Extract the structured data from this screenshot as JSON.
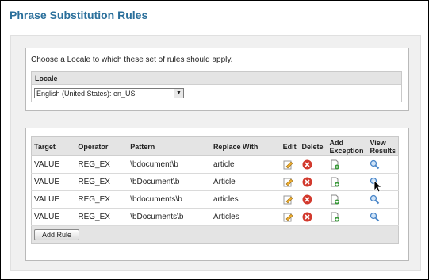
{
  "page": {
    "title": "Phrase Substitution Rules"
  },
  "locale_section": {
    "prompt": "Choose a Locale to which these set of rules should apply.",
    "header": "Locale",
    "selected_locale": "English (United States): en_US"
  },
  "rules": {
    "columns": {
      "target": "Target",
      "operator": "Operator",
      "pattern": "Pattern",
      "replace_with": "Replace With",
      "edit": "Edit",
      "delete": "Delete",
      "add_exception": "Add Exception",
      "view_results": "View Results"
    },
    "rows": [
      {
        "target": "VALUE",
        "operator": "REG_EX",
        "pattern": "\\bdocument\\b",
        "replace_with": "article"
      },
      {
        "target": "VALUE",
        "operator": "REG_EX",
        "pattern": "\\bDocument\\b",
        "replace_with": "Article"
      },
      {
        "target": "VALUE",
        "operator": "REG_EX",
        "pattern": "\\bdocuments\\b",
        "replace_with": "articles"
      },
      {
        "target": "VALUE",
        "operator": "REG_EX",
        "pattern": "\\bDocuments\\b",
        "replace_with": "Articles"
      }
    ],
    "add_rule_label": "Add Rule",
    "icons": {
      "edit": "pencil-icon",
      "delete": "delete-x-icon",
      "add_exception": "add-document-icon",
      "view_results": "magnifier-icon"
    }
  },
  "colors": {
    "title": "#2a6f9b",
    "delete_icon": "#d23a2e",
    "add_icon": "#3a9a3a",
    "magnifier": "#4a86c8"
  }
}
